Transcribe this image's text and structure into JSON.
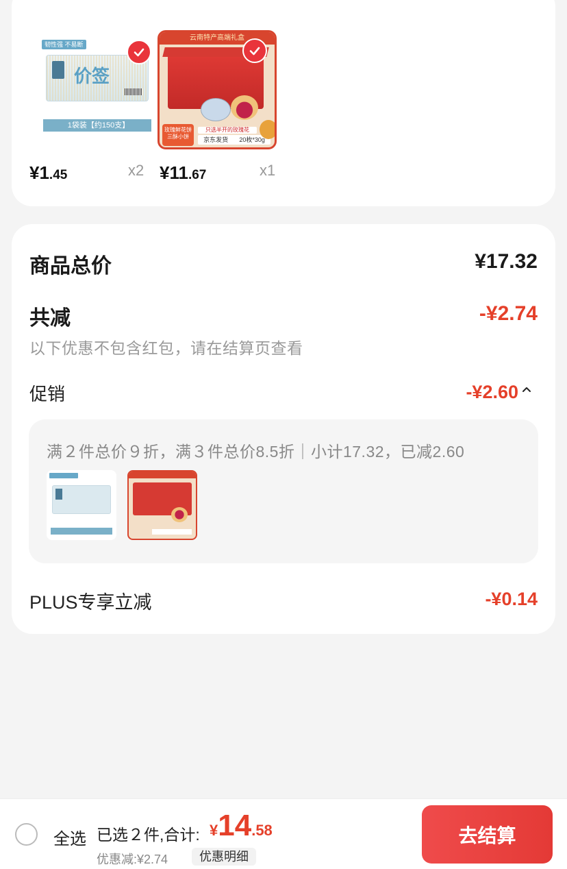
{
  "products": [
    {
      "image_label": "1袋装【约150支】",
      "tag": "韧性强 不易断",
      "title_art": "价签",
      "price_int": "¥1",
      "price_dec": ".45",
      "qty": "x2"
    },
    {
      "banner": "云南特产高端礼盒",
      "side_text": "玫瑰鲜花饼 三酥小饼",
      "info_top": "只选半开的玫瑰花",
      "info_left": "京东发货",
      "info_right": "20枚*30g",
      "price_int": "¥11",
      "price_dec": ".67",
      "qty": "x1"
    }
  ],
  "summary": {
    "total_label": "商品总价",
    "total_value": "¥17.32",
    "discount_label": "共减",
    "discount_value": "-¥2.74",
    "note": "以下优惠不包含红包，请在结算页查看",
    "promo_label": "促销",
    "promo_value": "-¥2.60",
    "promo_desc": "满２件总价９折，满３件总价8.5折｜小计17.32，已减2.60",
    "plus_label": "PLUS专享立减",
    "plus_value": "-¥0.14"
  },
  "bottom_bar": {
    "select_all": "全选",
    "selected_text": "已选２件,合计:",
    "currency": "¥",
    "total_int": "14",
    "total_dec": ".58",
    "saved_text": "优惠减:¥2.74",
    "detail_button": "优惠明细",
    "checkout_button": "去结算"
  },
  "colors": {
    "accent": "#e5402a",
    "checkout": "#e43a36",
    "check": "#e9343b"
  },
  "icons": [
    "check-icon",
    "caret-up-icon",
    "radio-icon"
  ]
}
